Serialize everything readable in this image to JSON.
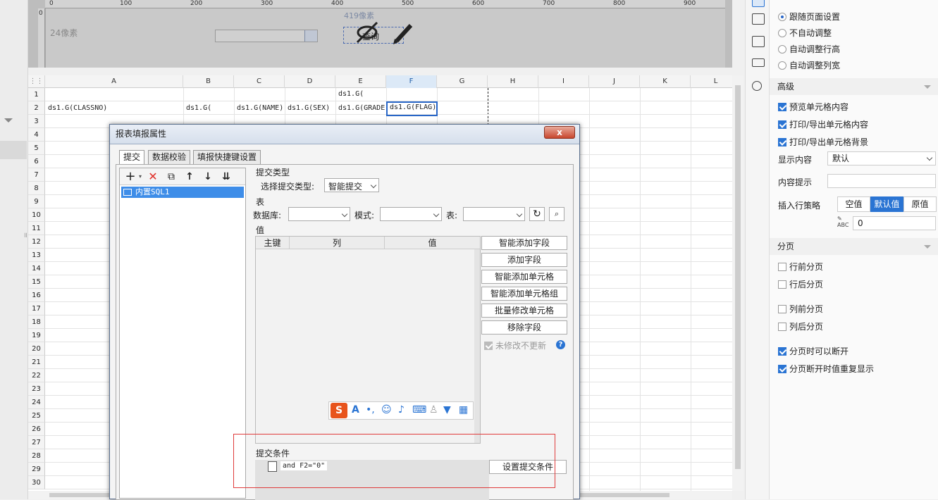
{
  "ruler": {
    "top_ticks": [
      "0",
      "100",
      "200",
      "300",
      "400",
      "500",
      "600",
      "700",
      "800",
      "900"
    ],
    "left_ticks": [
      "0"
    ]
  },
  "param_area": {
    "label_24": "24像素",
    "label_419": "419像素",
    "query_button": "查询"
  },
  "sheet": {
    "columns": [
      "A",
      "B",
      "C",
      "D",
      "E",
      "F",
      "G",
      "H",
      "I",
      "J",
      "K",
      "L"
    ],
    "selected_column": "F",
    "rows": [
      "1",
      "2",
      "3",
      "4",
      "5",
      "6",
      "7",
      "8",
      "9",
      "10",
      "11",
      "12",
      "13",
      "14",
      "15",
      "16",
      "17",
      "18",
      "19",
      "20",
      "21",
      "22",
      "23",
      "24",
      "25",
      "26",
      "27",
      "28",
      "29",
      "30"
    ],
    "cells": {
      "E1": "ds1.G(",
      "A2": "ds1.G(CLASSNO)",
      "B2": "ds1.G(",
      "C2": "ds1.G(NAME)",
      "D2": "ds1.G(SEX)",
      "E2": "ds1.G(GRADE",
      "F2": "ds1.G(FLAG)"
    }
  },
  "right_panel": {
    "resize_options": [
      {
        "label": "跟随页面设置",
        "selected": true
      },
      {
        "label": "不自动调整",
        "selected": false
      },
      {
        "label": "自动调整行高",
        "selected": false
      },
      {
        "label": "自动调整列宽",
        "selected": false
      }
    ],
    "advanced_title": "高级",
    "advanced_checks": [
      {
        "label": "预览单元格内容",
        "checked": true
      },
      {
        "label": "打印/导出单元格内容",
        "checked": true
      },
      {
        "label": "打印/导出单元格背景",
        "checked": true
      }
    ],
    "display_content_label": "显示内容",
    "display_content_value": "默认",
    "content_hint_label": "内容提示",
    "insert_policy_label": "插入行策略",
    "insert_policy_options": [
      "空值",
      "默认值",
      "原值"
    ],
    "insert_policy_selected": "默认值",
    "insert_value": "0",
    "paging_title": "分页",
    "paging_checks": [
      {
        "label": "行前分页",
        "checked": false
      },
      {
        "label": "行后分页",
        "checked": false
      },
      {
        "label": "列前分页",
        "checked": false
      },
      {
        "label": "列后分页",
        "checked": false
      },
      {
        "label": "分页时可以断开",
        "checked": true
      },
      {
        "label": "分页断开时值重复显示",
        "checked": true
      }
    ]
  },
  "dialog": {
    "title": "报表填报属性",
    "close": "x",
    "tabs": [
      "提交",
      "数据校验",
      "填报快捷键设置"
    ],
    "active_tab": "提交",
    "list_item": "内置SQL1",
    "submit_type_group": "提交类型",
    "submit_type_label": "选择提交类型:",
    "submit_type_value": "智能提交",
    "table_group": "表",
    "db_label": "数据库:",
    "schema_label": "模式:",
    "table_label": "表:",
    "value_group": "值",
    "value_headers": [
      "主键",
      "列",
      "值"
    ],
    "buttons": [
      "智能添加字段",
      "添加字段",
      "智能添加单元格",
      "智能添加单元格组",
      "批量修改单元格",
      "移除字段"
    ],
    "not_modified_label": "未修改不更新",
    "condition_group": "提交条件",
    "condition_item": "and F2=\"0\"",
    "set_condition_button": "设置提交条件"
  },
  "colors": {
    "accent": "#2a74d3",
    "highlight_box": "#e03b3b",
    "list_selected": "#3e8de8"
  }
}
